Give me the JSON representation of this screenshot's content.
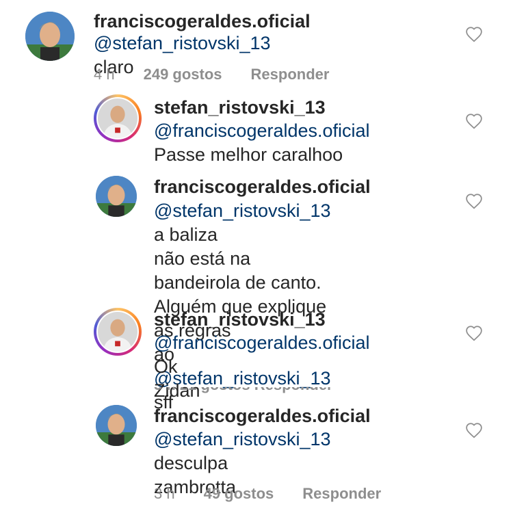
{
  "comments": [
    {
      "username": "franciscogeraldes.oficial",
      "mention": "@stefan_ristovski_13",
      "text": " claro",
      "time": "4 h",
      "likes": "249 gostos",
      "reply": "Responder"
    },
    {
      "username": "stefan_ristovski_13",
      "mention": "@franciscogeraldes.oficial",
      "text_line2": "Passe melhor caralhoo"
    },
    {
      "username": "franciscogeraldes.oficial",
      "mention": "@stefan_ristovski_13",
      "text1": " a baliza",
      "text2": "não está na bandeirola de canto.",
      "text3": "Alguém que explique as regras",
      "text4_pre": "ao ",
      "mention2": "@stefan_ristovski_13",
      "text4_post": " sff"
    },
    {
      "username": "stefan_ristovski_13",
      "mention": "@franciscogeraldes.oficial",
      "text1": " Ok",
      "text2": "Zidan",
      "cut_meta": "3 h   21 gostos   Responder"
    },
    {
      "username": "franciscogeraldes.oficial",
      "mention": "@stefan_ristovski_13",
      "text1": " desculpa",
      "text2": "zambrotta",
      "time": "3 h",
      "likes": "49 gostos",
      "reply": "Responder"
    }
  ],
  "icons": {
    "like": "heart-outline-icon",
    "avatar_francisco": "profile-photo-francisco",
    "avatar_stefan": "profile-photo-stefan-story-ring"
  },
  "colors": {
    "mention": "#003569",
    "meta": "#8e8e8e",
    "text": "#262626"
  }
}
